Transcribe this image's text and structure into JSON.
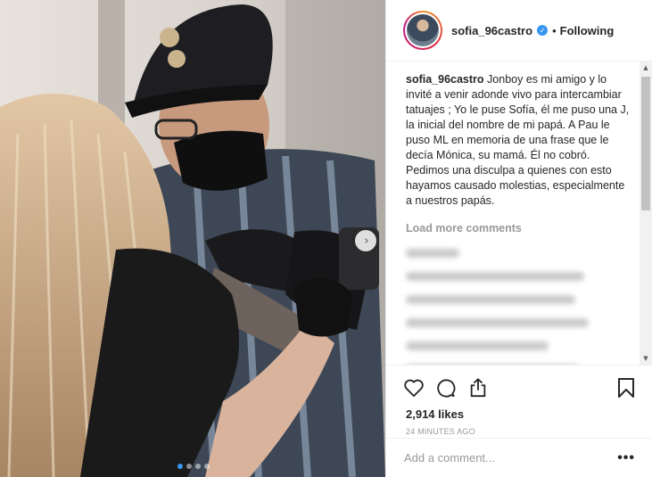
{
  "header": {
    "username": "sofia_96castro",
    "separator": "•",
    "follow_status": "Following",
    "verified_mark": "✓"
  },
  "photo": {
    "next_arrow": "›",
    "carousel": {
      "count": 4,
      "active_index": 0
    }
  },
  "caption": {
    "username": "sofia_96castro",
    "text": "Jonboy es mi amigo y lo invité a venir adonde vivo para intercambiar tatuajes ; Yo le puse Sofía, él me puso una J, la inicial del nombre de mi papá. A Pau le puso ML en memoria de una frase que le decía Mónica, su mamá. Él no cobró. Pedimos una disculpa a quienes con esto hayamos causado molestias, especialmente a nuestros papás."
  },
  "comments": {
    "load_more": "Load more comments",
    "scroll_up": "▲",
    "scroll_down": "▼"
  },
  "actions": {
    "icons": [
      "heart-icon",
      "comment-icon",
      "share-icon",
      "bookmark-icon"
    ]
  },
  "likes": "2,914 likes",
  "timestamp": "24 MINUTES AGO",
  "add_comment": {
    "placeholder": "Add a comment...",
    "more_label": "•••"
  },
  "colors": {
    "accent": "#3897f0",
    "text": "#262626",
    "muted": "#999999",
    "border": "#efefef"
  }
}
